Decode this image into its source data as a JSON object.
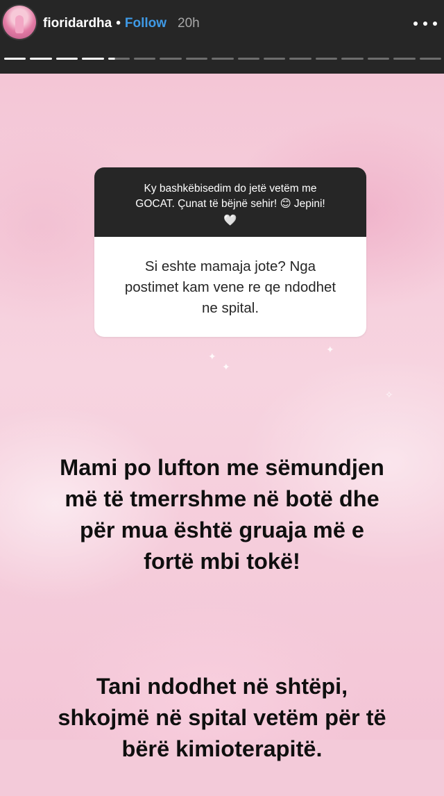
{
  "header": {
    "username": "fioridardha",
    "separator": "•",
    "follow_label": "Follow",
    "time_ago": "20h",
    "progress": {
      "segments_total": 17,
      "segments_viewed": 4,
      "current_segment_fraction": 0.3
    }
  },
  "question_box": {
    "prompt_line1": "Ky bashkëbisedim do jetë vetëm me",
    "prompt_line2": "GOCAT. Çunat të bëjnë sehir! 😊 Jepini!",
    "prompt_heart": "🤍",
    "question": "Si eshte mamaja jote? Nga postimet kam vene re qe ndodhet ne spital."
  },
  "answer": {
    "paragraph1": "Mami po lufton me sëmundjen\nmë të tmerrshme në botë dhe\npër mua është gruaja më e\nfortë mbi tokë!",
    "paragraph2": "Tani ndodhet në shtëpi,\nshkojmë në spital vetëm për të\nbërë kimioterapitë."
  },
  "colors": {
    "header_bg": "#262626",
    "follow_blue": "#3f9ae6",
    "story_bg_pink": "#f4c6d6"
  }
}
